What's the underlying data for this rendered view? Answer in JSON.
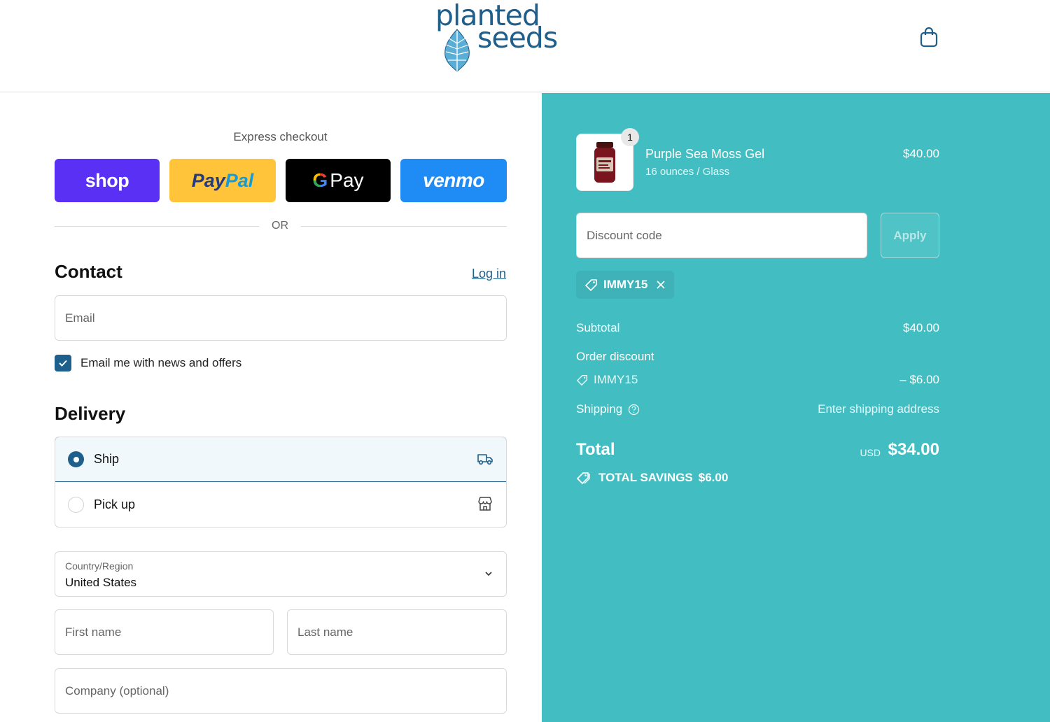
{
  "brand": {
    "name_line1": "planted",
    "name_line2": "seeds",
    "color": "#1f5f8c"
  },
  "express": {
    "title": "Express checkout",
    "shop_label": "shop",
    "paypal_label_a": "Pay",
    "paypal_label_b": "Pal",
    "gpay_g": "G",
    "gpay_label": "Pay",
    "venmo_label": "venmo",
    "or_label": "OR"
  },
  "contact": {
    "title": "Contact",
    "login_label": "Log in",
    "email_placeholder": "Email",
    "newsletter_label": "Email me with news and offers",
    "newsletter_checked": true
  },
  "delivery": {
    "title": "Delivery",
    "options": [
      {
        "label": "Ship",
        "selected": true,
        "icon": "truck-icon"
      },
      {
        "label": "Pick up",
        "selected": false,
        "icon": "store-icon"
      }
    ],
    "country_label": "Country/Region",
    "country_value": "United States",
    "first_name_placeholder": "First name",
    "last_name_placeholder": "Last name",
    "company_placeholder": "Company (optional)"
  },
  "summary": {
    "product": {
      "name": "Purple Sea Moss Gel",
      "variant": "16 ounces / Glass",
      "price": "$40.00",
      "quantity": "1"
    },
    "discount_placeholder": "Discount code",
    "apply_label": "Apply",
    "applied_code": "IMMY15",
    "subtotal_label": "Subtotal",
    "subtotal_value": "$40.00",
    "order_discount_label": "Order discount",
    "order_discount_code": "IMMY15",
    "order_discount_value": "– $6.00",
    "shipping_label": "Shipping",
    "shipping_value": "Enter shipping address",
    "total_label": "Total",
    "total_currency": "USD",
    "total_value": "$34.00",
    "savings_label": "TOTAL SAVINGS",
    "savings_value": "$6.00"
  },
  "colors": {
    "summary_bg": "#42bec2",
    "accent": "#1f5f8c"
  }
}
